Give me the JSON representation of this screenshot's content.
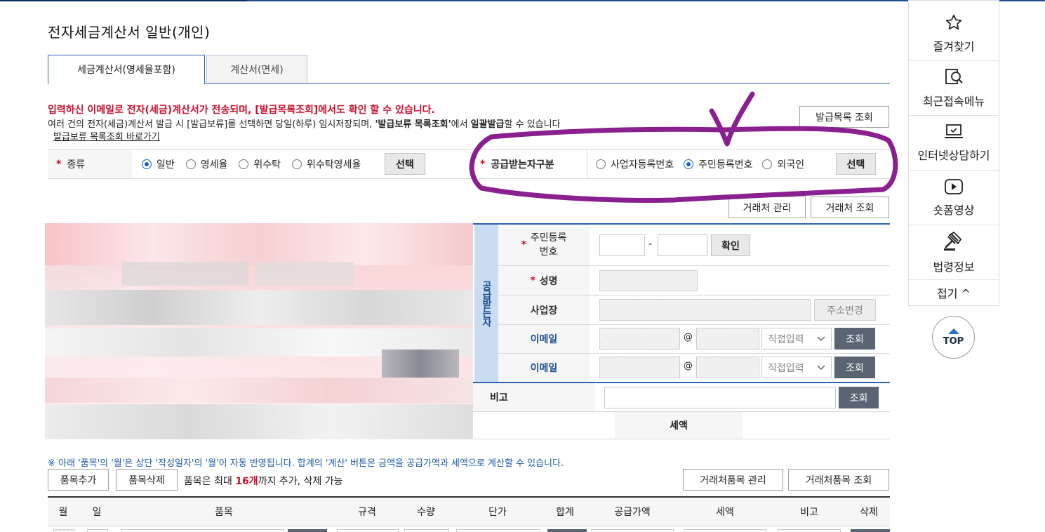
{
  "page_title": "전자세금계산서 일반(개인)",
  "tabs": [
    {
      "label": "세금계산서(영세율포함)",
      "active": true
    },
    {
      "label": "계산서(면세)",
      "active": false
    }
  ],
  "notice": {
    "line1": "입력하신 이메일로 전자(세금)계산서가 전송되며, [발급목록조회]에서도 확인 할 수 있습니다.",
    "line2_a": "여러 건의 전자(세금)계산서 발급 시 [발급보류]를 선택하면 당일(하루) 임시저장되며, ",
    "line2_b": "'발급보류 목록조회'",
    "line2_c": "에서 ",
    "line2_d": "일괄발급",
    "line2_e": "할 수 있습니다",
    "link": "발급보류 목록조회 바로가기",
    "issue_list_button": "발급목록 조회"
  },
  "type_row": {
    "label": "종류",
    "options": [
      "일반",
      "영세율",
      "위수탁",
      "위수탁영세율"
    ],
    "selected": "일반",
    "select_button": "선택"
  },
  "recipient_type_row": {
    "label": "공급받는자구분",
    "options": [
      "사업자등록번호",
      "주민등록번호",
      "외국인"
    ],
    "selected": "주민등록번호",
    "select_button": "선택"
  },
  "partner_buttons": {
    "manage": "거래처 관리",
    "lookup": "거래처 조회"
  },
  "recipient": {
    "band_label": "공급받는자",
    "rrn_label": "주민등록\n번호",
    "rrn_sep": "-",
    "confirm_button": "확인",
    "name_label": "성명",
    "workplace_label": "사업장",
    "address_change_button": "주소변경",
    "email1_label": "이메일",
    "email2_label": "이메일",
    "at_sign": "@",
    "domain_select": "직접입력",
    "lookup_button": "조회"
  },
  "remark": {
    "label": "비고",
    "lookup_button": "조회"
  },
  "tax_label": "세액",
  "items": {
    "note": "※ 아래 '품목'의 '월'은 상단 '작성일자'의 '월'이 자동 반영됩니다. 합계의 '계산' 버튼은 금액을 공급가액과 세액으로 계산할 수 있습니다.",
    "add_button": "품목추가",
    "delete_button": "품목삭제",
    "limit_prefix": "품목은 최대 ",
    "limit_count": "16개",
    "limit_suffix": "까지 추가, 삭제 가능",
    "partner_item_manage": "거래처품목 관리",
    "partner_item_lookup": "거래처품목 조회",
    "columns": [
      "월",
      "일",
      "품목",
      "규격",
      "수량",
      "단가",
      "합계",
      "공급가액",
      "세액",
      "비고",
      "삭제"
    ]
  },
  "right_panel": {
    "items": [
      {
        "label": "즐겨찾기",
        "icon": "star-icon"
      },
      {
        "label": "최근접속메뉴",
        "icon": "recent-menu-icon"
      },
      {
        "label": "인터넷상담하기",
        "icon": "laptop-chat-icon"
      },
      {
        "label": "숏폼영상",
        "icon": "play-icon"
      },
      {
        "label": "법령정보",
        "icon": "gavel-icon"
      }
    ],
    "fold": "접기 ^",
    "top": "TOP"
  },
  "colors": {
    "accent": "#2d64b3",
    "required": "#c8102e",
    "annotation": "#8a1f8f"
  }
}
